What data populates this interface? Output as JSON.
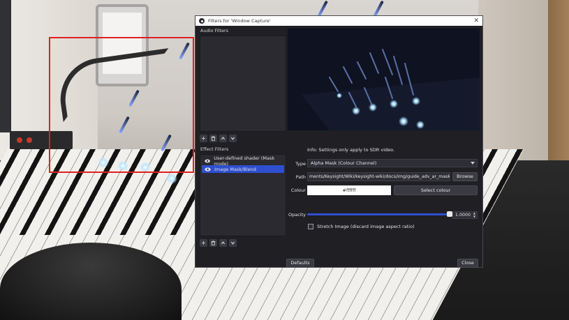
{
  "dialog": {
    "title": "Filters for 'Window Capture'",
    "close_glyph": "✕"
  },
  "audio_filters": {
    "label": "Audio Filters",
    "items": []
  },
  "effect_filters": {
    "label": "Effect Filters",
    "items": [
      {
        "label": "User-defined shader (Mask mode)",
        "selected": false
      },
      {
        "label": "Image Mask/Blend",
        "selected": true
      }
    ]
  },
  "toolbar": {
    "add_glyph": "+",
    "icons": [
      "plus-icon",
      "trash-icon",
      "chevron-up-icon",
      "chevron-down-icon"
    ]
  },
  "properties": {
    "info": "Info: Settings only apply to SDR video.",
    "type_label": "Type",
    "type_value": "Alpha Mask (Colour Channel)",
    "path_label": "Path",
    "path_value": "ments/Keysight/Wiki/keysight-wiki/docs/img/guide_adv_ar_mask.jpg",
    "browse_label": "Browse",
    "colour_label": "Colour",
    "colour_value": "#ffffff",
    "select_colour_label": "Select colour",
    "opacity_label": "Opacity",
    "opacity_value": "1.0000",
    "opacity_fraction": 1.0,
    "stretch_label": "Stretch Image (discard image aspect ratio)",
    "stretch_checked": false
  },
  "buttons": {
    "defaults_label": "Defaults",
    "close_label": "Close"
  },
  "colors": {
    "accent": "#2f4fd0",
    "selection_box": "#e02020",
    "dialog_bg": "#1f1f24"
  }
}
